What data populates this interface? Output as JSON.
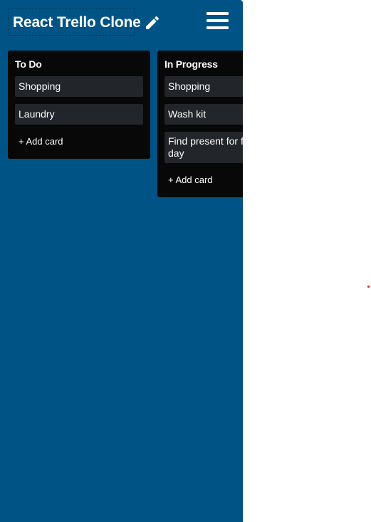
{
  "header": {
    "title": "React Trello Clone",
    "edit_icon": "pencil-icon",
    "menu_icon": "hamburger-menu-icon"
  },
  "lists": [
    {
      "title": "To Do",
      "cards": [
        "Shopping",
        "Laundry"
      ],
      "add_card_label": "+ Add card"
    },
    {
      "title": "In Progress",
      "cards": [
        "Shopping",
        "Wash kit",
        "Find present for f day"
      ],
      "add_card_label": "+ Add card"
    }
  ],
  "colors": {
    "board_background": "#005485",
    "list_background": "#080808",
    "card_background": "#22252a",
    "text": "#ffffff"
  }
}
